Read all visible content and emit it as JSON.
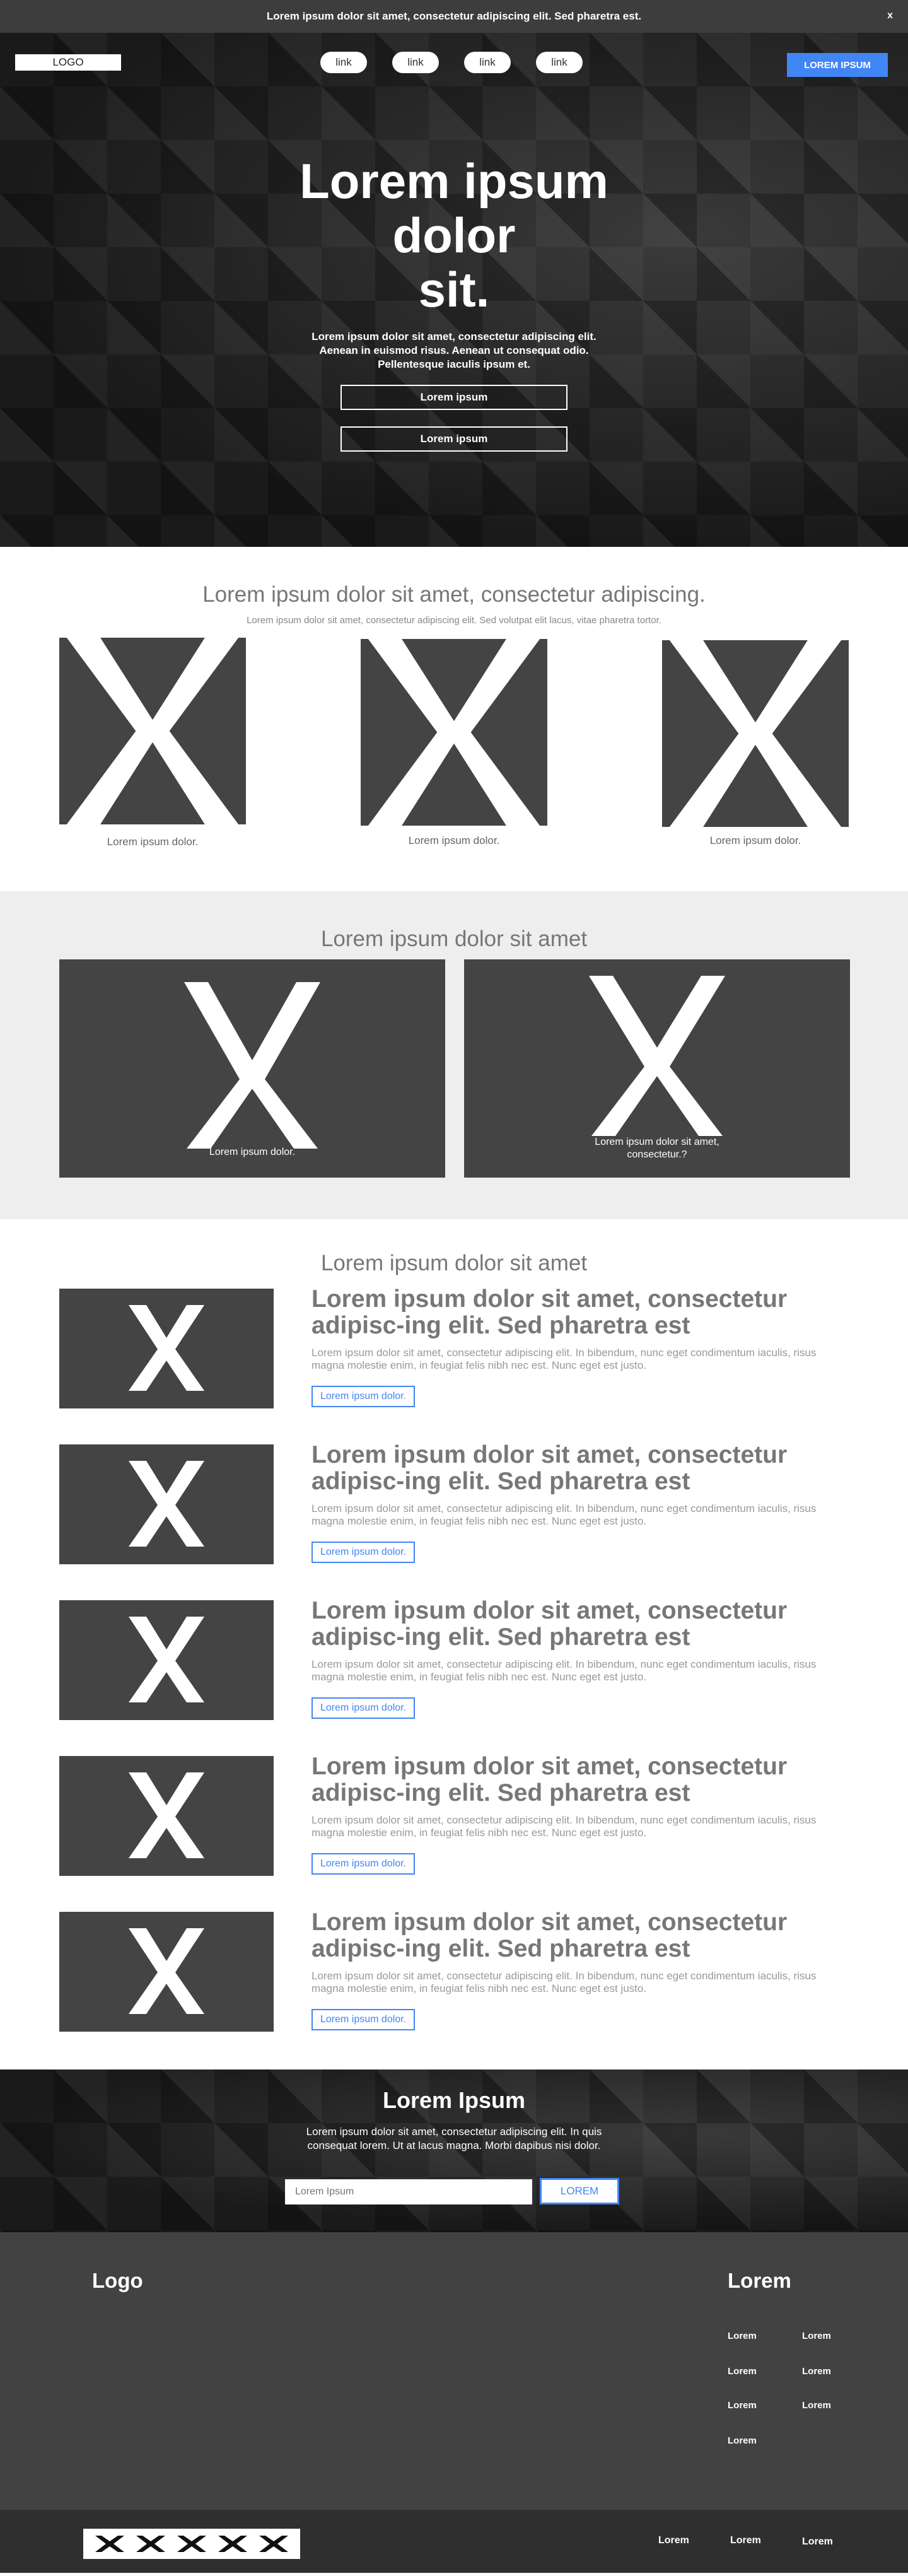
{
  "banner": {
    "text": "Lorem ipsum dolor sit amet, consectetur adipiscing elit. Sed pharetra est.",
    "close": "x"
  },
  "nav": {
    "logo": "LOGO",
    "links": [
      "link",
      "link",
      "link",
      "link"
    ],
    "cta": "LOREM IPSUM"
  },
  "hero": {
    "title_lines": [
      "Lorem ipsum",
      "dolor",
      "sit."
    ],
    "subtitle": "Lorem ipsum dolor sit amet, consectetur adipiscing elit. Aenean in euismod risus. Aenean ut consequat odio. Pellentesque iaculis ipsum et.",
    "buttons": [
      "Lorem ipsum",
      "Lorem ipsum"
    ]
  },
  "features": {
    "title": "Lorem ipsum dolor sit amet, consectetur adipiscing.",
    "subtitle": "Lorem ipsum dolor sit amet, consectetur adipiscing elit. Sed volutpat elit lacus, vitae pharetra tortor.",
    "captions": [
      "Lorem ipsum dolor.",
      "Lorem ipsum dolor.",
      "Lorem ipsum dolor."
    ]
  },
  "gallery": {
    "title": "Lorem ipsum dolor sit amet",
    "captions": [
      "Lorem ipsum dolor.",
      "Lorem ipsum dolor sit amet, consectetur.?"
    ]
  },
  "list": {
    "title": "Lorem ipsum dolor sit amet",
    "items": [
      {
        "title": "Lorem ipsum dolor sit amet, consectetur adipisc-ing elit. Sed pharetra est",
        "text": "Lorem ipsum dolor sit amet, consectetur adipiscing elit. In bibendum, nunc eget condimentum iaculis, risus magna molestie enim, in feugiat felis nibh nec est. Nunc eget est justo.",
        "button": "Lorem ipsum dolor."
      },
      {
        "title": "Lorem ipsum dolor sit amet, consectetur adipisc-ing elit. Sed pharetra est",
        "text": "Lorem ipsum dolor sit amet, consectetur adipiscing elit. In bibendum, nunc eget condimentum iaculis, risus magna molestie enim, in feugiat felis nibh nec est. Nunc eget est justo.",
        "button": "Lorem ipsum dolor."
      },
      {
        "title": "Lorem ipsum dolor sit amet, consectetur adipisc-ing elit. Sed pharetra est",
        "text": "Lorem ipsum dolor sit amet, consectetur adipiscing elit. In bibendum, nunc eget condimentum iaculis, risus magna molestie enim, in feugiat felis nibh nec est. Nunc eget est justo.",
        "button": "Lorem ipsum dolor."
      },
      {
        "title": "Lorem ipsum dolor sit amet, consectetur adipisc-ing elit. Sed pharetra est",
        "text": "Lorem ipsum dolor sit amet, consectetur adipiscing elit. In bibendum, nunc eget condimentum iaculis, risus magna molestie enim, in feugiat felis nibh nec est. Nunc eget est justo.",
        "button": "Lorem ipsum dolor."
      },
      {
        "title": "Lorem ipsum dolor sit amet, consectetur adipisc-ing elit. Sed pharetra est",
        "text": "Lorem ipsum dolor sit amet, consectetur adipiscing elit. In bibendum, nunc eget condimentum iaculis, risus magna molestie enim, in feugiat felis nibh nec est. Nunc eget est justo.",
        "button": "Lorem ipsum dolor."
      }
    ]
  },
  "newsletter": {
    "title": "Lorem Ipsum",
    "text": "Lorem ipsum dolor sit amet, consectetur adipiscing elit. In quis consequat lorem. Ut at lacus magna. Morbi dapibus nisi dolor.",
    "placeholder": "Lorem Ipsum",
    "button": "LOREM"
  },
  "footer": {
    "logo": "Logo",
    "heading": "Lorem",
    "links": [
      "Lorem",
      "Lorem",
      "Lorem",
      "Lorem",
      "Lorem",
      "Lorem",
      "Lorem"
    ]
  },
  "bottom": {
    "social_icons": [
      "x-icon",
      "x-icon",
      "x-icon",
      "x-icon",
      "x-icon"
    ],
    "links": [
      "Lorem",
      "Lorem",
      "Lorem"
    ]
  },
  "colors": {
    "accent": "#4285f4",
    "dark": "#444444",
    "banner": "#3d3d3d",
    "footer": "#424242",
    "bottom_bar": "#2f2f2f"
  }
}
